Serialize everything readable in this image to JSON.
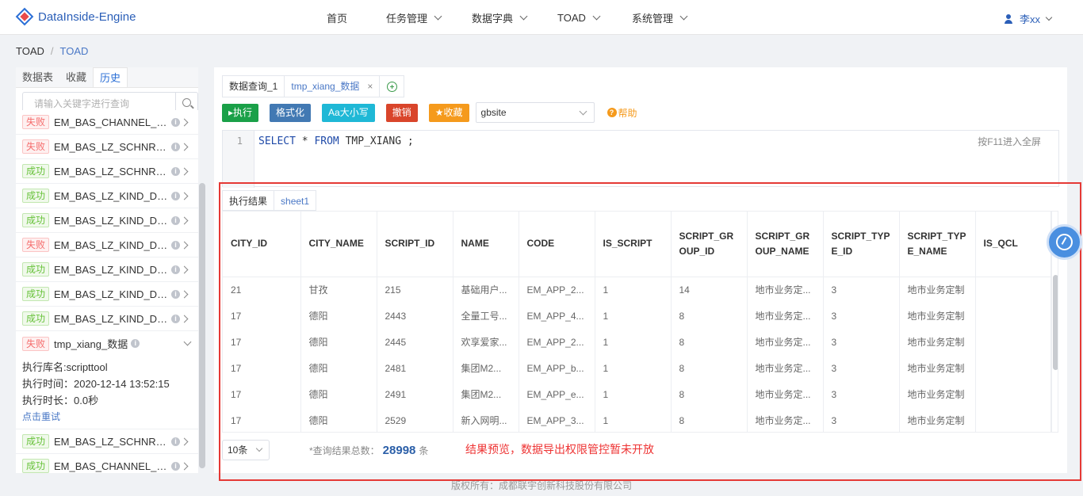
{
  "app": {
    "logo_text": "DataInside-Engine"
  },
  "nav": {
    "items": [
      {
        "label": "首页",
        "has_dropdown": false
      },
      {
        "label": "任务管理",
        "has_dropdown": true
      },
      {
        "label": "数据字典",
        "has_dropdown": true
      },
      {
        "label": "TOAD",
        "has_dropdown": true,
        "active": true
      },
      {
        "label": "系统管理",
        "has_dropdown": true
      }
    ],
    "user": "李xx",
    "active_color": "#2b5fb8"
  },
  "breadcrumb": {
    "root": "TOAD",
    "separator": "/",
    "current": "TOAD"
  },
  "sidebar": {
    "tabs": [
      "数据表",
      "收藏",
      "历史"
    ],
    "active_tab": "历史",
    "search_placeholder": "请输入关键字进行查询",
    "history": [
      {
        "status": "失败",
        "status_type": "fail",
        "name": "EM_BAS_CHANNEL_IN..."
      },
      {
        "status": "失败",
        "status_type": "fail",
        "name": "EM_BAS_LZ_SCHNRES_..."
      },
      {
        "status": "成功",
        "status_type": "ok",
        "name": "EM_BAS_LZ_SCHNRES_..."
      },
      {
        "status": "成功",
        "status_type": "ok",
        "name": "EM_BAS_LZ_KIND_DICT..."
      },
      {
        "status": "成功",
        "status_type": "ok",
        "name": "EM_BAS_LZ_KIND_DICT..."
      },
      {
        "status": "失败",
        "status_type": "fail",
        "name": "EM_BAS_LZ_KIND_DICT..."
      },
      {
        "status": "成功",
        "status_type": "ok",
        "name": "EM_BAS_LZ_KIND_DICT..."
      },
      {
        "status": "成功",
        "status_type": "ok",
        "name": "EM_BAS_LZ_KIND_DICT..."
      },
      {
        "status": "成功",
        "status_type": "ok",
        "name": "EM_BAS_LZ_KIND_DICT..."
      }
    ],
    "expanded": {
      "status": "失败",
      "status_type": "fail",
      "name": "tmp_xiang_数据",
      "db_line": "执行库名:scripttool",
      "time_line": "执行时间：2020-12-14 13:52:15",
      "duration_line": "执行时长：0.0秒",
      "retry_label": "点击重试"
    },
    "history_after": [
      {
        "status": "成功",
        "status_type": "ok",
        "name": "EM_BAS_LZ_SCHNRES_..."
      },
      {
        "status": "成功",
        "status_type": "ok",
        "name": "EM_BAS_CHANNEL_IN..."
      }
    ]
  },
  "editor_tabs": [
    {
      "label": "数据查询_1",
      "closable": false
    },
    {
      "label": "tmp_xiang_数据",
      "closable": true,
      "close_glyph": "×"
    }
  ],
  "toolbar": {
    "run": "▸执行",
    "format": "格式化",
    "case": "Aa大小写",
    "undo": "撤销",
    "favorite": "★收藏",
    "datasource": "gbsite",
    "help": "帮助",
    "help_glyph": "?"
  },
  "editor": {
    "line_number": "1",
    "kw_select": "SELECT",
    "star": " * ",
    "kw_from": "FROM",
    "rest": " TMP_XIANG ;",
    "fullscreen_hint": "按F11进入全屏"
  },
  "result_tabs": [
    "执行结果",
    "sheet1"
  ],
  "result": {
    "columns": [
      "CITY_ID",
      "CITY_NAME",
      "SCRIPT_ID",
      "NAME",
      "CODE",
      "IS_SCRIPT",
      "SCRIPT_GROUP_ID",
      "SCRIPT_GROUP_NAME",
      "SCRIPT_TYPE_ID",
      "SCRIPT_TYPE_NAME",
      "IS_QCL"
    ],
    "rows": [
      [
        "21",
        "甘孜",
        "215",
        "基础用户...",
        "EM_APP_2...",
        "1",
        "14",
        "地市业务定...",
        "3",
        "地市业务定制",
        ""
      ],
      [
        "17",
        "德阳",
        "2443",
        "全量工号...",
        "EM_APP_4...",
        "1",
        "8",
        "地市业务定...",
        "3",
        "地市业务定制",
        ""
      ],
      [
        "17",
        "德阳",
        "2445",
        "欢享爱家...",
        "EM_APP_2...",
        "1",
        "8",
        "地市业务定...",
        "3",
        "地市业务定制",
        ""
      ],
      [
        "17",
        "德阳",
        "2481",
        "集团M2...",
        "EM_APP_b...",
        "1",
        "8",
        "地市业务定...",
        "3",
        "地市业务定制",
        ""
      ],
      [
        "17",
        "德阳",
        "2491",
        "集团M2...",
        "EM_APP_e...",
        "1",
        "8",
        "地市业务定...",
        "3",
        "地市业务定制",
        ""
      ],
      [
        "17",
        "德阳",
        "2529",
        "新入网明...",
        "EM_APP_3...",
        "1",
        "8",
        "地市业务定...",
        "3",
        "地市业务定制",
        ""
      ]
    ],
    "page_size": "10条",
    "total_prefix": "*查询结果总数：",
    "total_count": "28998",
    "total_suffix": "条",
    "notice": "结果预览，数据导出权限管控暂未开放"
  },
  "copyright": "版权所有：成都联宇创新科技股份有限公司"
}
